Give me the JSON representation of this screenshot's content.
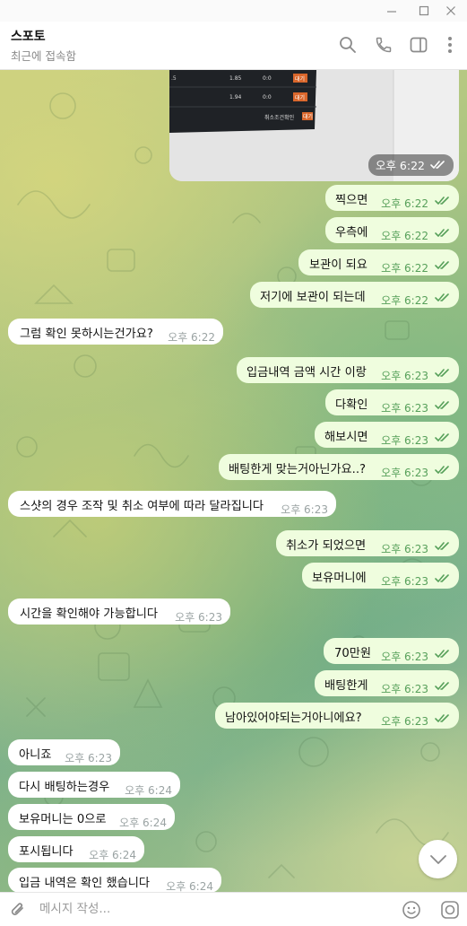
{
  "header": {
    "name": "스포토",
    "status": "최근에 접속함"
  },
  "photo": {
    "time": "오후 6:22",
    "table_rows": [
      {
        "left": ".5",
        "odds": "1.85",
        "score": "0:0",
        "badge": "대기"
      },
      {
        "left": "",
        "odds": "1.94",
        "score": "0:0",
        "badge": "대기"
      }
    ],
    "footer_label": "취소조건확인",
    "footer_badge": "대기"
  },
  "messages": [
    {
      "dir": "out",
      "text": "찍으면",
      "time": "오후 6:22"
    },
    {
      "dir": "out",
      "text": "우측에",
      "time": "오후 6:22"
    },
    {
      "dir": "out",
      "text": "보관이 되요",
      "time": "오후 6:22"
    },
    {
      "dir": "out",
      "text": "저기에 보관이 되는데",
      "time": "오후 6:22"
    },
    {
      "dir": "in",
      "text": "그럼 확인 못하시는건가요?",
      "time": "오후 6:22"
    },
    {
      "dir": "out",
      "text": "입금내역 금액 시간 이랑",
      "time": "오후 6:23"
    },
    {
      "dir": "out",
      "text": "다확인",
      "time": "오후 6:23"
    },
    {
      "dir": "out",
      "text": "해보시면",
      "time": "오후 6:23"
    },
    {
      "dir": "out",
      "text": "배팅한게 맞는거아닌가요..?",
      "time": "오후 6:23"
    },
    {
      "dir": "in",
      "text": "스샷의 경우 조작 및 취소 여부에 따라 달라집니다",
      "time": "오후 6:23"
    },
    {
      "dir": "out",
      "text": "취소가 되었으면",
      "time": "오후 6:23"
    },
    {
      "dir": "out",
      "text": "보유머니에",
      "time": "오후 6:23"
    },
    {
      "dir": "in",
      "text": "시간을 확인해야 가능합니다",
      "time": "오후 6:23"
    },
    {
      "dir": "out",
      "text": "70만원",
      "time": "오후 6:23"
    },
    {
      "dir": "out",
      "text": "배팅한게",
      "time": "오후 6:23"
    },
    {
      "dir": "out",
      "text": "남아있어야되는거아니에요?",
      "time": "오후 6:23"
    },
    {
      "dir": "in",
      "text": "아니죠",
      "time": "오후 6:23"
    },
    {
      "dir": "in",
      "text": "다시 배팅하는경우",
      "time": "오후 6:24"
    },
    {
      "dir": "in",
      "text": "보유머니는 0으로",
      "time": "오후 6:24"
    },
    {
      "dir": "in",
      "text": "포시됩니다",
      "time": "오후 6:24"
    },
    {
      "dir": "in",
      "text": "입금 내역은 확인 했습니다",
      "time": "오후 6:24"
    }
  ],
  "input": {
    "placeholder": "메시지 작성..."
  },
  "colors": {
    "bubble_out": "#effdde",
    "bubble_in": "#ffffff",
    "accent": "#57a05a"
  },
  "icons": [
    "minimize-icon",
    "maximize-icon",
    "close-icon",
    "search-icon",
    "phone-icon",
    "sidebar-icon",
    "more-icon",
    "attach-icon",
    "emoji-icon",
    "camera-icon",
    "read-receipt-icon",
    "scroll-down-icon"
  ]
}
